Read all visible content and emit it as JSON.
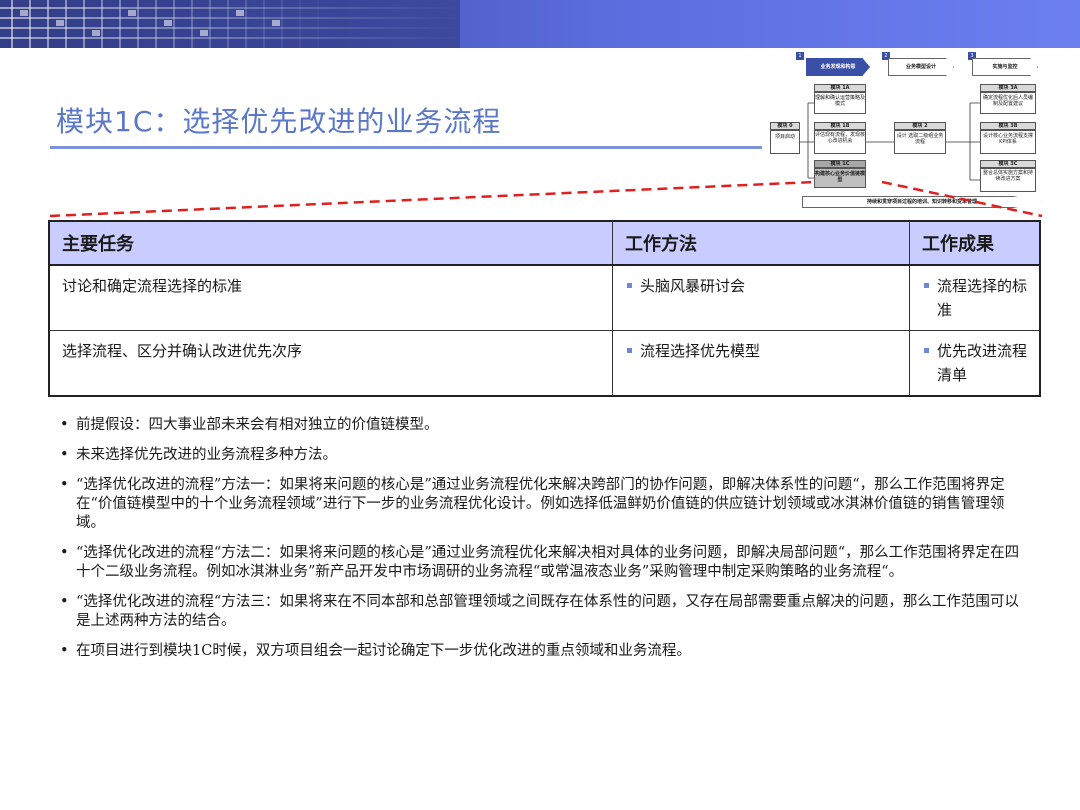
{
  "title": "模块1C：选择优先改进的业务流程",
  "diagram": {
    "steps": [
      {
        "num": "1",
        "label": "业务发现和构思"
      },
      {
        "num": "2",
        "label": "业务模型设计"
      },
      {
        "num": "3",
        "label": "实施与监控"
      }
    ],
    "module0": {
      "head": "模块 0",
      "body": "项目启动"
    },
    "module1a": {
      "head": "模块 1A",
      "body": "理解和确认运营策略及模式"
    },
    "module1b": {
      "head": "模块 1B",
      "body": "评估现有流程，发现核心改进机会"
    },
    "module1c": {
      "head": "模块 1C",
      "body": "构建核心业务价值链模型"
    },
    "module2": {
      "head": "模块 2",
      "body": "设计 选取二级组业务流程"
    },
    "module3a": {
      "head": "模块 3A",
      "body": "确定流程优化后人员编制及配置建议"
    },
    "module3b": {
      "head": "模块 3B",
      "body": "设计核心业务流程支撑KPI体系"
    },
    "module3c": {
      "head": "模块 3C",
      "body": "整合总体实施方案和持续改进方案"
    },
    "footer_bar": "持续和贯穿项目过程的培训、知识转移和变革管理"
  },
  "table": {
    "headers": [
      "主要任务",
      "工作方法",
      "工作成果"
    ],
    "rows": [
      {
        "task": "讨论和确定流程选择的标准",
        "method": "头脑风暴研讨会",
        "result": "流程选择的标准"
      },
      {
        "task": "选择流程、区分并确认改进优先次序",
        "method": "流程选择优先模型",
        "result": "优先改进流程清单"
      }
    ]
  },
  "bullets": [
    "前提假设：四大事业部未来会有相对独立的价值链模型。",
    "未来选择优先改进的业务流程多种方法。",
    "“选择优化改进的流程”方法一：如果将来问题的核心是”通过业务流程优化来解决跨部门的协作问题，即解决体系性的问题“，那么工作范围将界定在“价值链模型中的十个业务流程领域”进行下一步的业务流程优化设计。例如选择低温鲜奶价值链的供应链计划领域或冰淇淋价值链的销售管理领域。",
    "“选择优化改进的流程“方法二：如果将来问题的核心是”通过业务流程优化来解决相对具体的业务问题，即解决局部问题“，那么工作范围将界定在四十个二级业务流程。例如冰淇淋业务”新产品开发中市场调研的业务流程“或常温液态业务”采购管理中制定采购策略的业务流程“。",
    "“选择优化改进的流程“方法三：如果将来在不同本部和总部管理领域之间既存在体系性的问题，又存在局部需要重点解决的问题，那么工作范围可以是上述两种方法的结合。",
    "在项目进行到模块1C时候，双方项目组会一起讨论确定下一步优化改进的重点领域和业务流程。"
  ],
  "colors": {
    "banner": "#4a5ac0",
    "title": "#5b78c8",
    "table_header": "#c8ccff",
    "bullet_square": "#6f87d8",
    "dashed_line": "#e02020"
  }
}
